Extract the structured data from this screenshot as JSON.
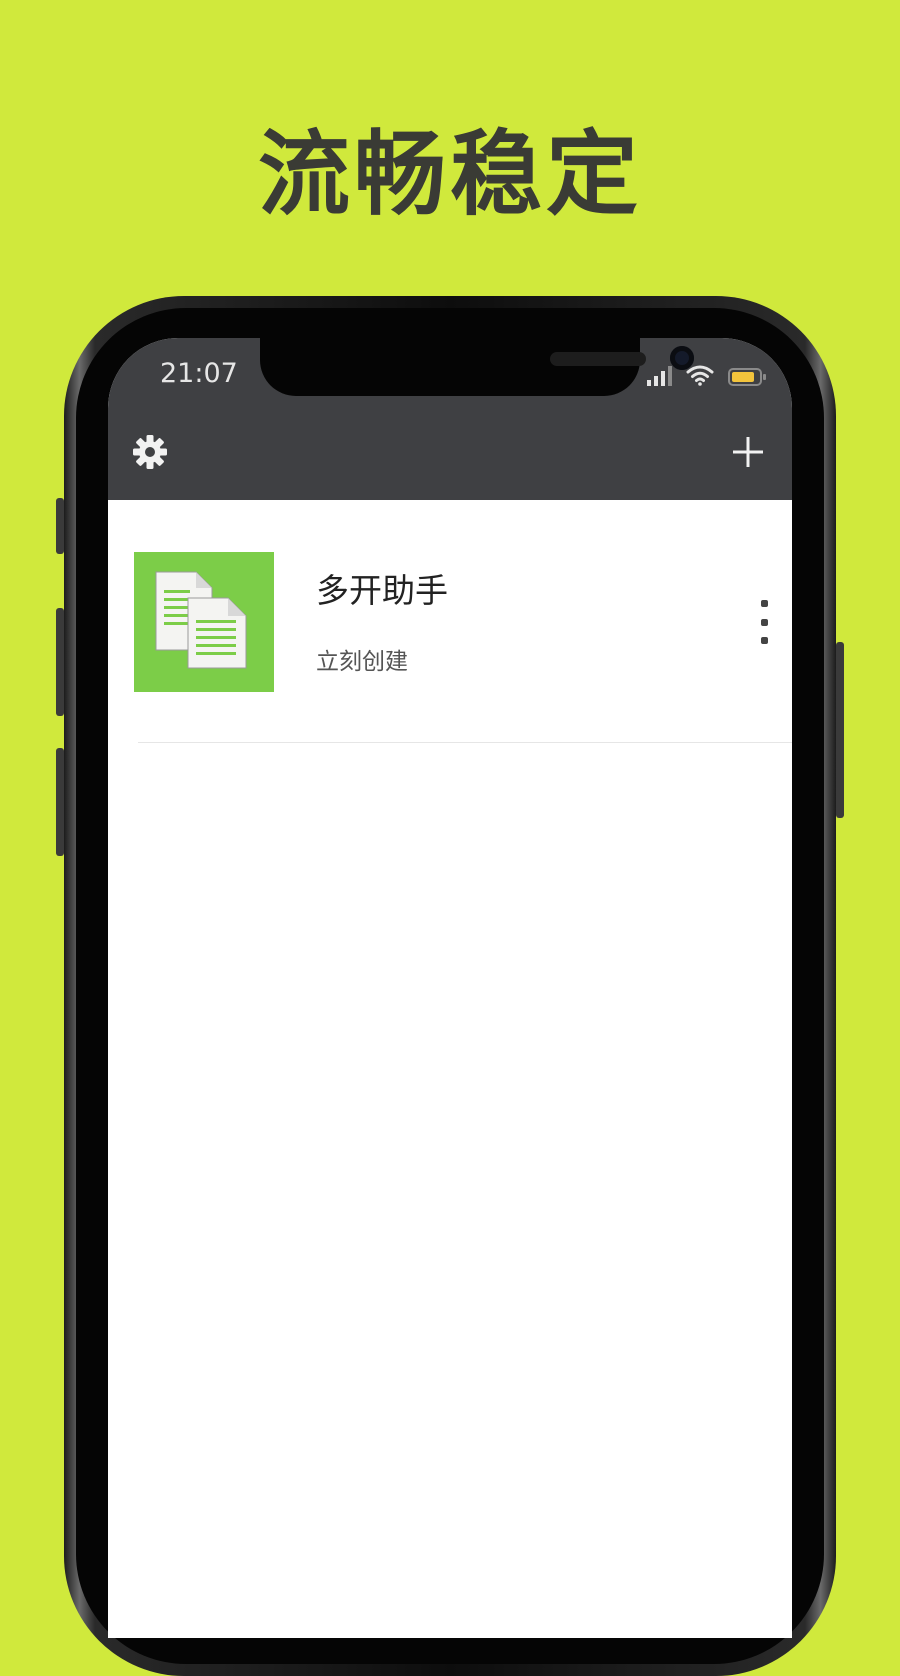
{
  "headline": "流畅稳定",
  "status_bar": {
    "time": "21:07",
    "icons": [
      "signal-icon",
      "wifi-icon",
      "battery-icon"
    ],
    "battery_color": "#f3c43c"
  },
  "app_bar": {
    "left_icon": "gear-icon",
    "right_icon": "plus-icon",
    "background": "#3f4043"
  },
  "items": [
    {
      "title": "多开助手",
      "subtitle": "立刻创建",
      "icon": "copy-documents-icon",
      "icon_background": "#7ccd48",
      "menu_icon": "more-vertical-icon"
    }
  ],
  "colors": {
    "page_background": "#d0e93c",
    "headline_text": "#3a3b35"
  }
}
